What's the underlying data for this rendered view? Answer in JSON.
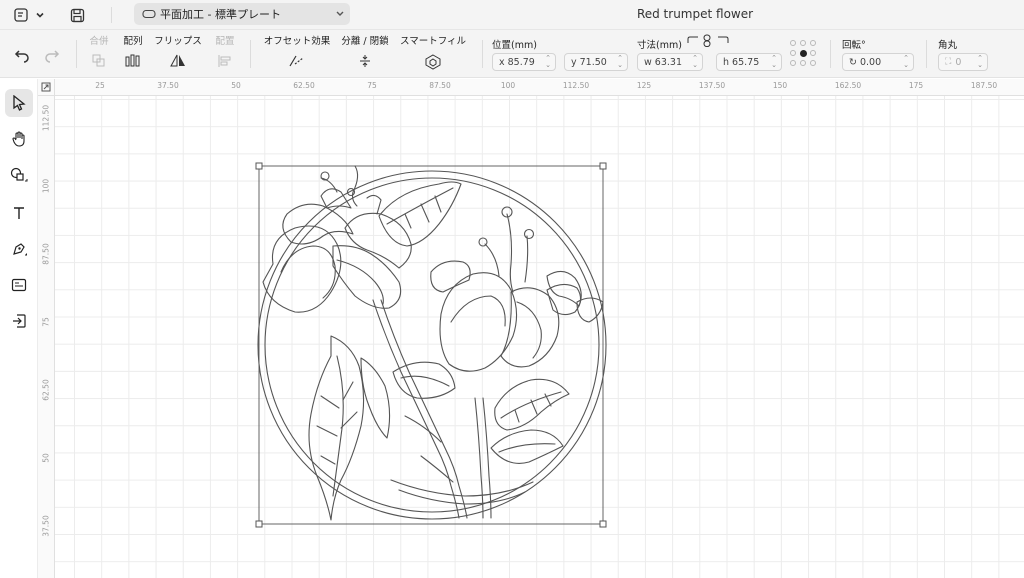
{
  "titlebar": {
    "file_icon": "file-menu-icon",
    "plate_label": "平面加工 - 標準プレート",
    "doc_title": "Red trumpet flower"
  },
  "toolbar": {
    "combine": "合併",
    "arrange": "配列",
    "flips": "フリップス",
    "align": "配置",
    "offset": "オフセット効果",
    "split": "分離 / 閉鎖",
    "smart_fill": "スマートフィル",
    "position_label": "位置(mm)",
    "x_value": "x 85.79",
    "y_value": "y 71.50",
    "size_label": "寸法(mm)",
    "w_value": "w 63.31",
    "h_value": "h 65.75",
    "rotation_label": "回転°",
    "rotation_value": "0.00",
    "corner_label": "角丸",
    "corner_value": "0"
  },
  "ruler": {
    "h_ticks": [
      "25",
      "37.50",
      "50",
      "62.50",
      "75",
      "87.50",
      "100",
      "112.50",
      "125",
      "137.50",
      "150",
      "162.50",
      "175",
      "187.50"
    ],
    "v_ticks": [
      "112.50",
      "100",
      "87.50",
      "75",
      "62.50",
      "50",
      "37.50"
    ]
  },
  "lefttools": [
    "select-tool",
    "pan-tool",
    "shapes-tool",
    "text-tool",
    "pen-tool",
    "image-tool",
    "import-tool"
  ],
  "colors": {
    "accent": "#222222",
    "grid": "#ececec",
    "toolbar_bg": "#f4f4f4"
  }
}
